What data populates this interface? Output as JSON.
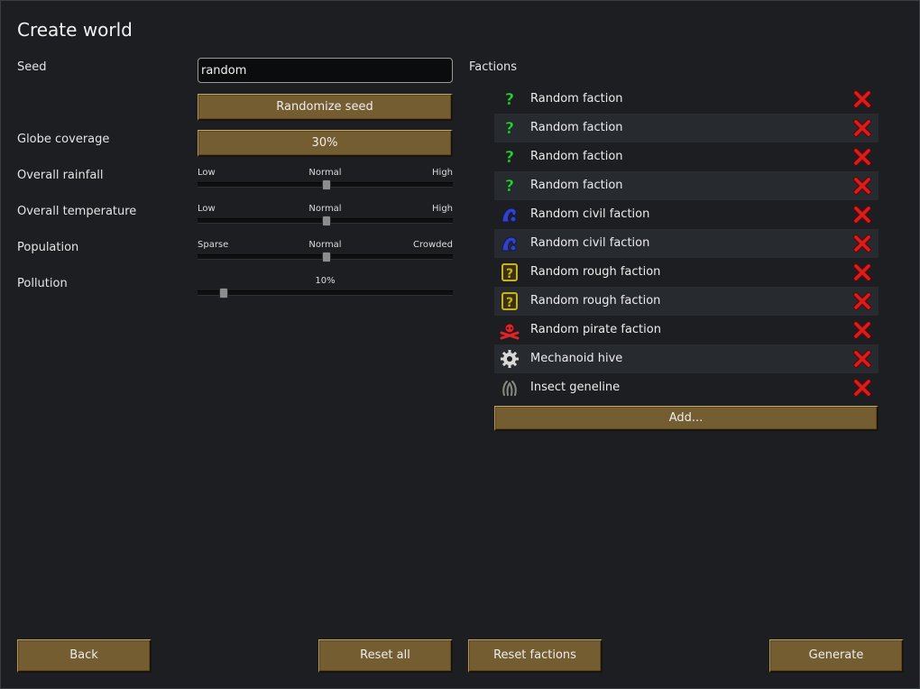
{
  "title": "Create world",
  "seed": {
    "label": "Seed",
    "value": "random",
    "randomize_label": "Randomize seed"
  },
  "globe_coverage": {
    "label": "Globe coverage",
    "value": "30%"
  },
  "rainfall": {
    "label": "Overall rainfall",
    "low": "Low",
    "mid": "Normal",
    "high": "High",
    "level": 0.5
  },
  "temperature": {
    "label": "Overall temperature",
    "low": "Low",
    "mid": "Normal",
    "high": "High",
    "level": 0.5
  },
  "population": {
    "label": "Population",
    "low": "Sparse",
    "mid": "Normal",
    "high": "Crowded",
    "level": 0.5
  },
  "pollution": {
    "label": "Pollution",
    "value": "10%",
    "level": 0.1
  },
  "factions": {
    "label": "Factions",
    "items": [
      {
        "name": "Random faction",
        "icon": "question-mark-icon",
        "color": "#2ecc40"
      },
      {
        "name": "Random faction",
        "icon": "question-mark-icon",
        "color": "#2ecc40"
      },
      {
        "name": "Random faction",
        "icon": "question-mark-icon",
        "color": "#2ecc40"
      },
      {
        "name": "Random faction",
        "icon": "question-mark-icon",
        "color": "#2ecc40"
      },
      {
        "name": "Random civil faction",
        "icon": "civil-faction-icon",
        "color": "#3340c8"
      },
      {
        "name": "Random civil faction",
        "icon": "civil-faction-icon",
        "color": "#3340c8"
      },
      {
        "name": "Random rough faction",
        "icon": "rough-faction-icon",
        "color": "#c8b21e"
      },
      {
        "name": "Random rough faction",
        "icon": "rough-faction-icon",
        "color": "#c8b21e"
      },
      {
        "name": "Random pirate faction",
        "icon": "pirate-faction-icon",
        "color": "#e0242a"
      },
      {
        "name": "Mechanoid hive",
        "icon": "gear-icon",
        "color": "#d8d8d8"
      },
      {
        "name": "Insect geneline",
        "icon": "insect-icon",
        "color": "#8a8a80"
      }
    ],
    "add_label": "Add..."
  },
  "footer": {
    "back": "Back",
    "reset_all": "Reset all",
    "reset_factions": "Reset factions",
    "generate": "Generate"
  },
  "colors": {
    "button": "#745d31",
    "remove": "#e01b1b",
    "background": "#1c1e21"
  }
}
